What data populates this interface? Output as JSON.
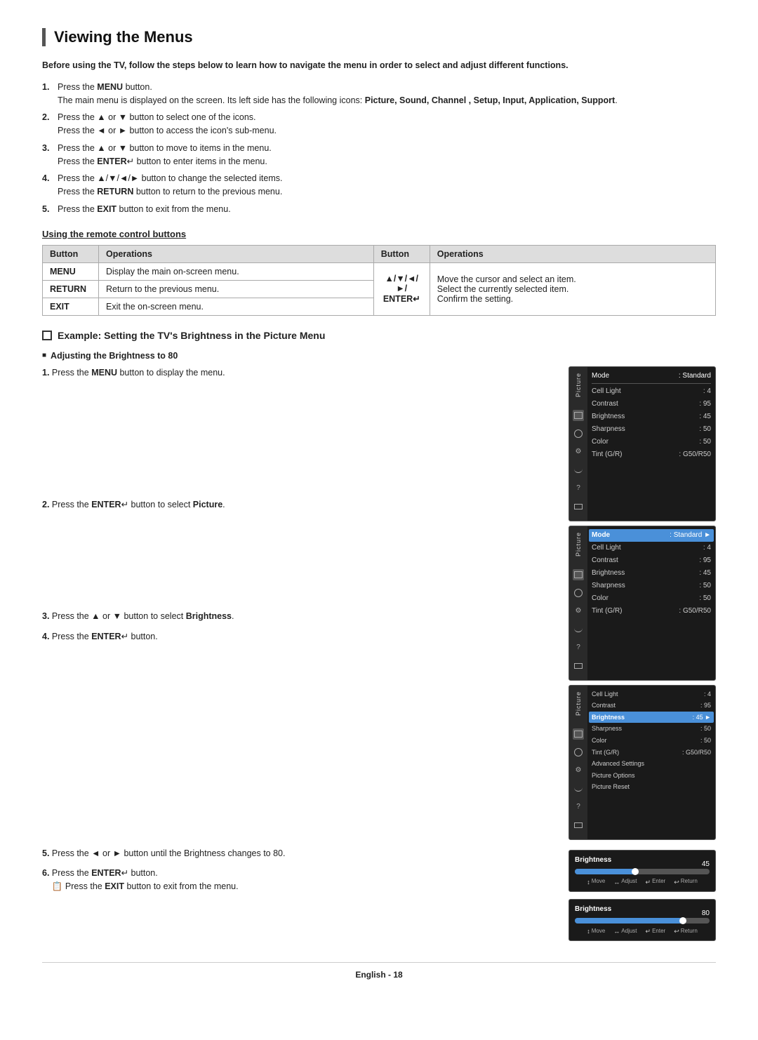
{
  "page": {
    "title": "Viewing the Menus",
    "footer": "English - 18"
  },
  "intro": {
    "text": "Before using the TV, follow the steps below to learn how to navigate the menu in order to select and adjust different functions."
  },
  "steps": [
    {
      "num": 1,
      "text": "Press the MENU button.",
      "subtext": "The main menu is displayed on the screen. Its left side has the following icons: Picture, Sound, Channel , Setup, Input, Application, Support."
    },
    {
      "num": 2,
      "text": "Press the ▲ or ▼ button to select one of the icons.",
      "subtext": "Press the ◄ or ► button to access the icon's sub-menu."
    },
    {
      "num": 3,
      "text": "Press the ▲ or ▼ button to move to items in the menu.",
      "subtext": "Press the ENTER button to enter items in the menu."
    },
    {
      "num": 4,
      "text": "Press the ▲/▼/◄/► button to change the selected items.",
      "subtext": "Press the RETURN button to return to the previous menu."
    },
    {
      "num": 5,
      "text": "Press the EXIT button to exit from the menu."
    }
  ],
  "remote_section": {
    "heading": "Using the remote control buttons",
    "table": {
      "headers": [
        "Button",
        "Operations",
        "Button",
        "Operations"
      ],
      "rows": [
        {
          "btn1": "MENU",
          "op1": "Display the main on-screen menu.",
          "btn2": "▲/▼/◄/►/\nENTER",
          "op2": "Move the cursor and select an item.\nSelect the currently selected item.\nConfirm the setting."
        },
        {
          "btn1": "RETURN",
          "op1": "Return to the previous menu.",
          "btn2": "",
          "op2": ""
        },
        {
          "btn1": "EXIT",
          "op1": "Exit the on-screen menu.",
          "btn2": "",
          "op2": ""
        }
      ]
    }
  },
  "example": {
    "heading": "Example: Setting the TV's Brightness in the Picture Menu",
    "sub_heading": "Adjusting the Brightness to 80",
    "step1": {
      "num": 1,
      "text": "Press the MENU button to display the menu."
    },
    "step2": {
      "num": 2,
      "text": "Press the ENTER button to select Picture."
    },
    "step3": {
      "num": 3,
      "text": "Press the ▲ or ▼ button to select Brightness."
    },
    "step4": {
      "num": 4,
      "text": "Press the ENTER button."
    },
    "step5": {
      "num": 5,
      "text": "Press the ◄ or ► button until the Brightness changes to 80."
    },
    "step6": {
      "num": 6,
      "text": "Press the ENTER button.",
      "subtext": "Press the EXIT button to exit from the menu."
    }
  },
  "screens": {
    "screen1": {
      "label": "Picture",
      "rows": [
        {
          "label": "Mode",
          "value": ": Standard"
        },
        {
          "label": "Cell Light",
          "value": ": 4"
        },
        {
          "label": "Contrast",
          "value": ": 95"
        },
        {
          "label": "Brightness",
          "value": ": 45"
        },
        {
          "label": "Sharpness",
          "value": ": 50"
        },
        {
          "label": "Color",
          "value": ": 50"
        },
        {
          "label": "Tint (G/R)",
          "value": ": G50/R50"
        }
      ]
    },
    "screen2": {
      "label": "Picture",
      "highlighted_row": "Mode",
      "rows": [
        {
          "label": "Mode",
          "value": ": Standard",
          "highlight": true
        },
        {
          "label": "Cell Light",
          "value": ": 4"
        },
        {
          "label": "Contrast",
          "value": ": 95"
        },
        {
          "label": "Brightness",
          "value": ": 45"
        },
        {
          "label": "Sharpness",
          "value": ": 50"
        },
        {
          "label": "Color",
          "value": ": 50"
        },
        {
          "label": "Tint (G/R)",
          "value": ": G50/R50"
        }
      ]
    },
    "screen3": {
      "label": "Picture",
      "highlighted_row": "Brightness",
      "rows": [
        {
          "label": "Cell Light",
          "value": ": 4"
        },
        {
          "label": "Contrast",
          "value": ": 95"
        },
        {
          "label": "Brightness",
          "value": ": 45",
          "highlight": true
        },
        {
          "label": "Sharpness",
          "value": ": 50"
        },
        {
          "label": "Color",
          "value": ": 50"
        },
        {
          "label": "Tint (G/R)",
          "value": ": G50/R50"
        },
        {
          "label": "Advanced Settings",
          "value": ""
        },
        {
          "label": "Picture Options",
          "value": ""
        },
        {
          "label": "Picture Reset",
          "value": ""
        }
      ]
    },
    "slider1": {
      "label": "Brightness",
      "value": 45,
      "max": 100,
      "controls": [
        "Move",
        "Adjust",
        "Enter",
        "Return"
      ]
    },
    "slider2": {
      "label": "Brightness",
      "value": 80,
      "max": 100,
      "controls": [
        "Move",
        "Adjust",
        "Enter",
        "Return"
      ]
    }
  }
}
